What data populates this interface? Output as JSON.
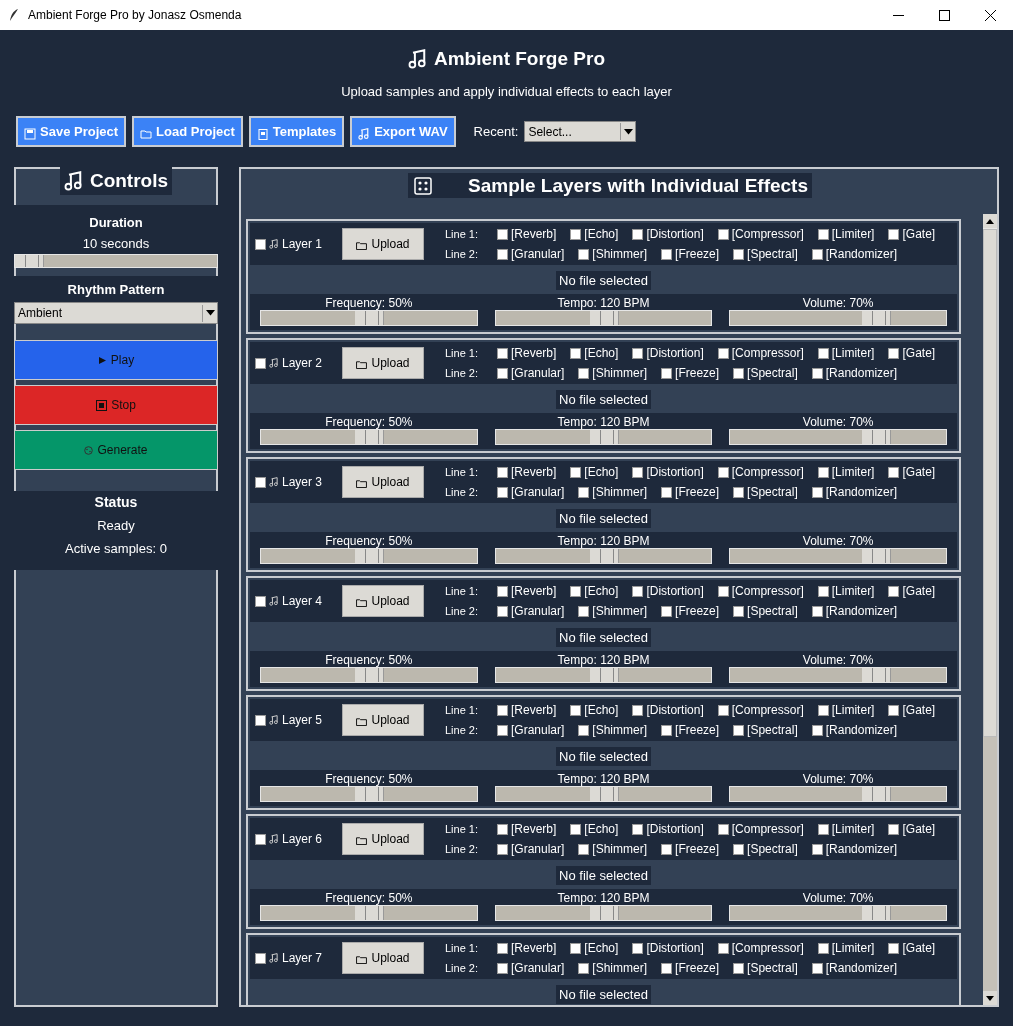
{
  "window": {
    "title": "Ambient Forge Pro by Jonasz Osmenda"
  },
  "header": {
    "title": "Ambient Forge Pro",
    "subtitle": "Upload samples and apply individual effects to each layer"
  },
  "toolbar": {
    "buttons": [
      {
        "label": "Save Project",
        "kind": "save"
      },
      {
        "label": "Load Project",
        "kind": "load"
      },
      {
        "label": "Templates",
        "kind": "templates"
      },
      {
        "label": "Export WAV",
        "kind": "export"
      }
    ],
    "recent_label": "Recent:",
    "recent_value": "Select..."
  },
  "controls": {
    "title": "Controls",
    "duration": {
      "label": "Duration",
      "value": "10 seconds",
      "level": 0
    },
    "rhythm_label": "Rhythm Pattern",
    "rhythm_value": "Ambient",
    "buttons": [
      {
        "label": "Play",
        "kind": "play"
      },
      {
        "label": "Stop",
        "kind": "stop"
      },
      {
        "label": "Generate",
        "kind": "generate"
      }
    ],
    "status_label": "Status",
    "status_value": "Ready",
    "active_samples": "Active samples: 0"
  },
  "layers_panel": {
    "title": "Sample Layers with Individual Effects",
    "layers": [
      {
        "label": "Layer 1",
        "checked": false,
        "upload": "Upload",
        "lines": [
          {
            "label": "Line 1:",
            "effects": [
              {
                "label": "[Reverb]",
                "checked": false
              },
              {
                "label": "[Echo]",
                "checked": false
              },
              {
                "label": "[Distortion]",
                "checked": false
              },
              {
                "label": "[Compressor]",
                "checked": false
              },
              {
                "label": "[Limiter]",
                "checked": false
              },
              {
                "label": "[Gate]",
                "checked": false
              }
            ]
          },
          {
            "label": "Line 2:",
            "effects": [
              {
                "label": "[Granular]",
                "checked": false
              },
              {
                "label": "[Shimmer]",
                "checked": false
              },
              {
                "label": "[Freeze]",
                "checked": false
              },
              {
                "label": "[Spectral]",
                "checked": false
              },
              {
                "label": "[Randomizer]",
                "checked": false
              }
            ]
          }
        ],
        "file": "No file selected",
        "sliders": [
          {
            "label": "Frequency: 50%",
            "level": 0.5
          },
          {
            "label": "Tempo: 120 BPM",
            "level": 0.5
          },
          {
            "label": "Volume: 70%",
            "level": 0.7
          }
        ]
      },
      {
        "label": "Layer 2",
        "checked": false,
        "upload": "Upload",
        "lines": [
          {
            "label": "Line 1:",
            "effects": [
              {
                "label": "[Reverb]",
                "checked": false
              },
              {
                "label": "[Echo]",
                "checked": false
              },
              {
                "label": "[Distortion]",
                "checked": false
              },
              {
                "label": "[Compressor]",
                "checked": false
              },
              {
                "label": "[Limiter]",
                "checked": false
              },
              {
                "label": "[Gate]",
                "checked": false
              }
            ]
          },
          {
            "label": "Line 2:",
            "effects": [
              {
                "label": "[Granular]",
                "checked": false
              },
              {
                "label": "[Shimmer]",
                "checked": false
              },
              {
                "label": "[Freeze]",
                "checked": false
              },
              {
                "label": "[Spectral]",
                "checked": false
              },
              {
                "label": "[Randomizer]",
                "checked": false
              }
            ]
          }
        ],
        "file": "No file selected",
        "sliders": [
          {
            "label": "Frequency: 50%",
            "level": 0.5
          },
          {
            "label": "Tempo: 120 BPM",
            "level": 0.5
          },
          {
            "label": "Volume: 70%",
            "level": 0.7
          }
        ]
      },
      {
        "label": "Layer 3",
        "checked": false,
        "upload": "Upload",
        "lines": [
          {
            "label": "Line 1:",
            "effects": [
              {
                "label": "[Reverb]",
                "checked": false
              },
              {
                "label": "[Echo]",
                "checked": false
              },
              {
                "label": "[Distortion]",
                "checked": false
              },
              {
                "label": "[Compressor]",
                "checked": false
              },
              {
                "label": "[Limiter]",
                "checked": false
              },
              {
                "label": "[Gate]",
                "checked": false
              }
            ]
          },
          {
            "label": "Line 2:",
            "effects": [
              {
                "label": "[Granular]",
                "checked": false
              },
              {
                "label": "[Shimmer]",
                "checked": false
              },
              {
                "label": "[Freeze]",
                "checked": false
              },
              {
                "label": "[Spectral]",
                "checked": false
              },
              {
                "label": "[Randomizer]",
                "checked": false
              }
            ]
          }
        ],
        "file": "No file selected",
        "sliders": [
          {
            "label": "Frequency: 50%",
            "level": 0.5
          },
          {
            "label": "Tempo: 120 BPM",
            "level": 0.5
          },
          {
            "label": "Volume: 70%",
            "level": 0.7
          }
        ]
      },
      {
        "label": "Layer 4",
        "checked": false,
        "upload": "Upload",
        "lines": [
          {
            "label": "Line 1:",
            "effects": [
              {
                "label": "[Reverb]",
                "checked": false
              },
              {
                "label": "[Echo]",
                "checked": false
              },
              {
                "label": "[Distortion]",
                "checked": false
              },
              {
                "label": "[Compressor]",
                "checked": false
              },
              {
                "label": "[Limiter]",
                "checked": false
              },
              {
                "label": "[Gate]",
                "checked": false
              }
            ]
          },
          {
            "label": "Line 2:",
            "effects": [
              {
                "label": "[Granular]",
                "checked": false
              },
              {
                "label": "[Shimmer]",
                "checked": false
              },
              {
                "label": "[Freeze]",
                "checked": false
              },
              {
                "label": "[Spectral]",
                "checked": false
              },
              {
                "label": "[Randomizer]",
                "checked": false
              }
            ]
          }
        ],
        "file": "No file selected",
        "sliders": [
          {
            "label": "Frequency: 50%",
            "level": 0.5
          },
          {
            "label": "Tempo: 120 BPM",
            "level": 0.5
          },
          {
            "label": "Volume: 70%",
            "level": 0.7
          }
        ]
      },
      {
        "label": "Layer 5",
        "checked": false,
        "upload": "Upload",
        "lines": [
          {
            "label": "Line 1:",
            "effects": [
              {
                "label": "[Reverb]",
                "checked": false
              },
              {
                "label": "[Echo]",
                "checked": false
              },
              {
                "label": "[Distortion]",
                "checked": false
              },
              {
                "label": "[Compressor]",
                "checked": false
              },
              {
                "label": "[Limiter]",
                "checked": false
              },
              {
                "label": "[Gate]",
                "checked": false
              }
            ]
          },
          {
            "label": "Line 2:",
            "effects": [
              {
                "label": "[Granular]",
                "checked": false
              },
              {
                "label": "[Shimmer]",
                "checked": false
              },
              {
                "label": "[Freeze]",
                "checked": false
              },
              {
                "label": "[Spectral]",
                "checked": false
              },
              {
                "label": "[Randomizer]",
                "checked": false
              }
            ]
          }
        ],
        "file": "No file selected",
        "sliders": [
          {
            "label": "Frequency: 50%",
            "level": 0.5
          },
          {
            "label": "Tempo: 120 BPM",
            "level": 0.5
          },
          {
            "label": "Volume: 70%",
            "level": 0.7
          }
        ]
      },
      {
        "label": "Layer 6",
        "checked": false,
        "upload": "Upload",
        "lines": [
          {
            "label": "Line 1:",
            "effects": [
              {
                "label": "[Reverb]",
                "checked": false
              },
              {
                "label": "[Echo]",
                "checked": false
              },
              {
                "label": "[Distortion]",
                "checked": false
              },
              {
                "label": "[Compressor]",
                "checked": false
              },
              {
                "label": "[Limiter]",
                "checked": false
              },
              {
                "label": "[Gate]",
                "checked": false
              }
            ]
          },
          {
            "label": "Line 2:",
            "effects": [
              {
                "label": "[Granular]",
                "checked": false
              },
              {
                "label": "[Shimmer]",
                "checked": false
              },
              {
                "label": "[Freeze]",
                "checked": false
              },
              {
                "label": "[Spectral]",
                "checked": false
              },
              {
                "label": "[Randomizer]",
                "checked": false
              }
            ]
          }
        ],
        "file": "No file selected",
        "sliders": [
          {
            "label": "Frequency: 50%",
            "level": 0.5
          },
          {
            "label": "Tempo: 120 BPM",
            "level": 0.5
          },
          {
            "label": "Volume: 70%",
            "level": 0.7
          }
        ]
      },
      {
        "label": "Layer 7",
        "checked": false,
        "upload": "Upload",
        "lines": [
          {
            "label": "Line 1:",
            "effects": [
              {
                "label": "[Reverb]",
                "checked": false
              },
              {
                "label": "[Echo]",
                "checked": false
              },
              {
                "label": "[Distortion]",
                "checked": false
              },
              {
                "label": "[Compressor]",
                "checked": false
              },
              {
                "label": "[Limiter]",
                "checked": false
              },
              {
                "label": "[Gate]",
                "checked": false
              }
            ]
          },
          {
            "label": "Line 2:",
            "effects": [
              {
                "label": "[Granular]",
                "checked": false
              },
              {
                "label": "[Shimmer]",
                "checked": false
              },
              {
                "label": "[Freeze]",
                "checked": false
              },
              {
                "label": "[Spectral]",
                "checked": false
              },
              {
                "label": "[Randomizer]",
                "checked": false
              }
            ]
          }
        ],
        "file": "No file selected"
      }
    ]
  }
}
